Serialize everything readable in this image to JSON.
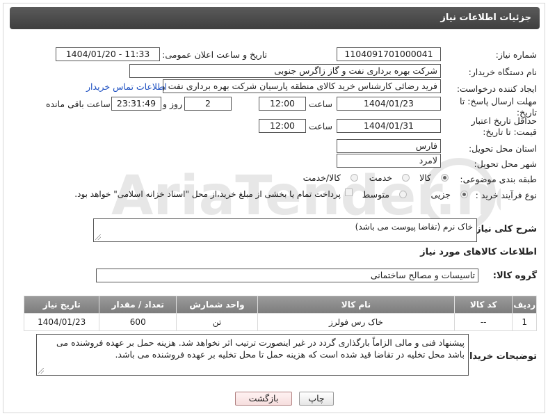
{
  "page": {
    "title": "جزئیات اطلاعات نیاز"
  },
  "fields": {
    "need_number_label": "شماره نیاز:",
    "need_number": "1104091701000041",
    "announce_label": "تاریخ و ساعت اعلان عمومی:",
    "announce_value": "1404/01/20 - 11:33",
    "buyer_org_label": "نام دستگاه خریدار:",
    "buyer_org": "شرکت بهره برداری نفت و گاز زاگرس جنوبی",
    "creator_label": "ایجاد کننده درخواست:",
    "creator": "فرید رضائی کارشناس خرید کالای منطقه پارسیان شرکت بهره برداری نفت و گاز",
    "buyer_contact_link": "اطلاعات تماس خریدار",
    "reply_deadline_label": "مهلت ارسال پاسخ: تا تاریخ:",
    "reply_date": "1404/01/23",
    "time_label": "ساعت",
    "reply_time": "12:00",
    "days_value": "2",
    "days_label": "روز و",
    "remaining_value": "23:31:49",
    "remaining_label": "ساعت باقی مانده",
    "price_validity_label": "حداقل تاریخ اعتبار قیمت: تا تاریخ:",
    "price_date": "1404/01/31",
    "price_time": "12:00",
    "province_label": "استان محل تحویل:",
    "province": "فارس",
    "city_label": "شهر محل تحویل:",
    "city": "لامرد",
    "category_label": "طبقه بندی موضوعی:",
    "category_options": [
      "کالا",
      "خدمت",
      "کالا/خدمت"
    ],
    "process_label": "نوع فرآیند خرید :",
    "process_options": [
      "جزیی",
      "متوسط"
    ],
    "payment_note": "پرداخت تمام یا بخشی از مبلغ خرید،از محل \"اسناد خزانه اسلامی\" خواهد بود."
  },
  "description": {
    "label": "شرح کلی نیاز:",
    "value": "خاک نرم (تقاضا پیوست می باشد)"
  },
  "goods": {
    "section_title": "اطلاعات کالاهای مورد نیاز",
    "group_label": "گروه کالا:",
    "group_value": "تاسیسات و مصالح ساختمانی",
    "columns": [
      "ردیف",
      "کد کالا",
      "نام کالا",
      "واحد شمارش",
      "تعداد / مقدار",
      "تاریخ نیاز"
    ],
    "rows": [
      [
        "1",
        "--",
        "خاک رس فولرز",
        "تن",
        "600",
        "1404/01/23"
      ]
    ]
  },
  "buyer_notes": {
    "label": "توضیحات خریدار:",
    "value": "پیشنهاد فنی و مالی الزاماً بارگذاری گردد در غیر اینصورت ترتیب اثر نخواهد شد. هزینه حمل بر عهده فروشنده می باشد محل تخلیه در تقاضا قید شده است که هزینه حمل تا محل تخلیه بر عهده فروشنده می باشد."
  },
  "buttons": {
    "print": "چاپ",
    "back": "بازگشت"
  },
  "watermark": "AriaTender.neT",
  "colors": {
    "link": "#1a4dc0",
    "header": "#4a4a4a",
    "table_header": "#8a8a8a"
  }
}
